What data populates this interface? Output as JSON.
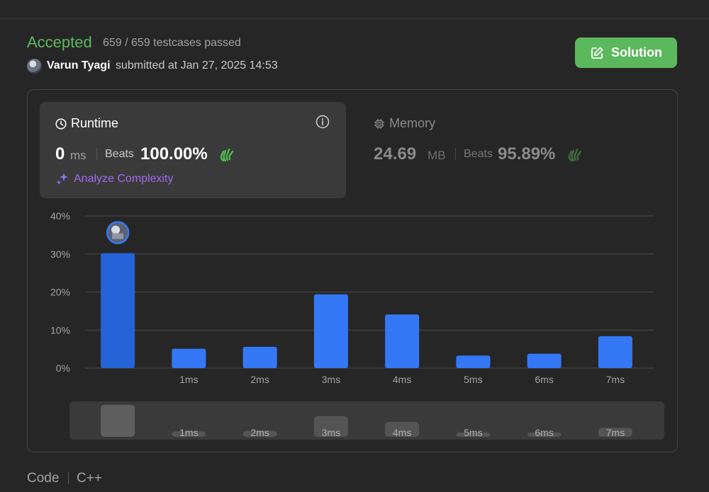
{
  "submission": {
    "status": "Accepted",
    "testcases": "659 / 659 testcases passed",
    "user": "Varun Tyagi",
    "submitted_text": "submitted at Jan 27, 2025 14:53",
    "solution_label": "Solution"
  },
  "runtime": {
    "title": "Runtime",
    "value": "0",
    "unit": "ms",
    "beats_label": "Beats",
    "beats_pct": "100.00%",
    "analyze_label": "Analyze Complexity"
  },
  "memory": {
    "title": "Memory",
    "value": "24.69",
    "unit": "MB",
    "beats_label": "Beats",
    "beats_pct": "95.89%"
  },
  "colors": {
    "accent_green": "#5cb85c",
    "bar_blue": "#3478f6",
    "bar_selected": "#2563d9",
    "analyze_purple": "#a06bf0"
  },
  "chart_data": {
    "type": "bar",
    "categories": [
      "",
      "1ms",
      "2ms",
      "3ms",
      "4ms",
      "5ms",
      "6ms",
      "7ms"
    ],
    "values": [
      30.2,
      5.1,
      5.6,
      19.4,
      14.1,
      3.3,
      3.8,
      8.4
    ],
    "ytick_labels": [
      "0%",
      "10%",
      "20%",
      "30%",
      "40%"
    ],
    "yticks": [
      0,
      10,
      20,
      30,
      40
    ],
    "ylim": [
      0,
      40
    ],
    "selected_index": 0,
    "grid": true,
    "minimap_labels": [
      "",
      "1ms",
      "2ms",
      "3ms",
      "4ms",
      "5ms",
      "6ms",
      "7ms"
    ]
  },
  "footer": {
    "code_label": "Code",
    "language": "C++"
  }
}
